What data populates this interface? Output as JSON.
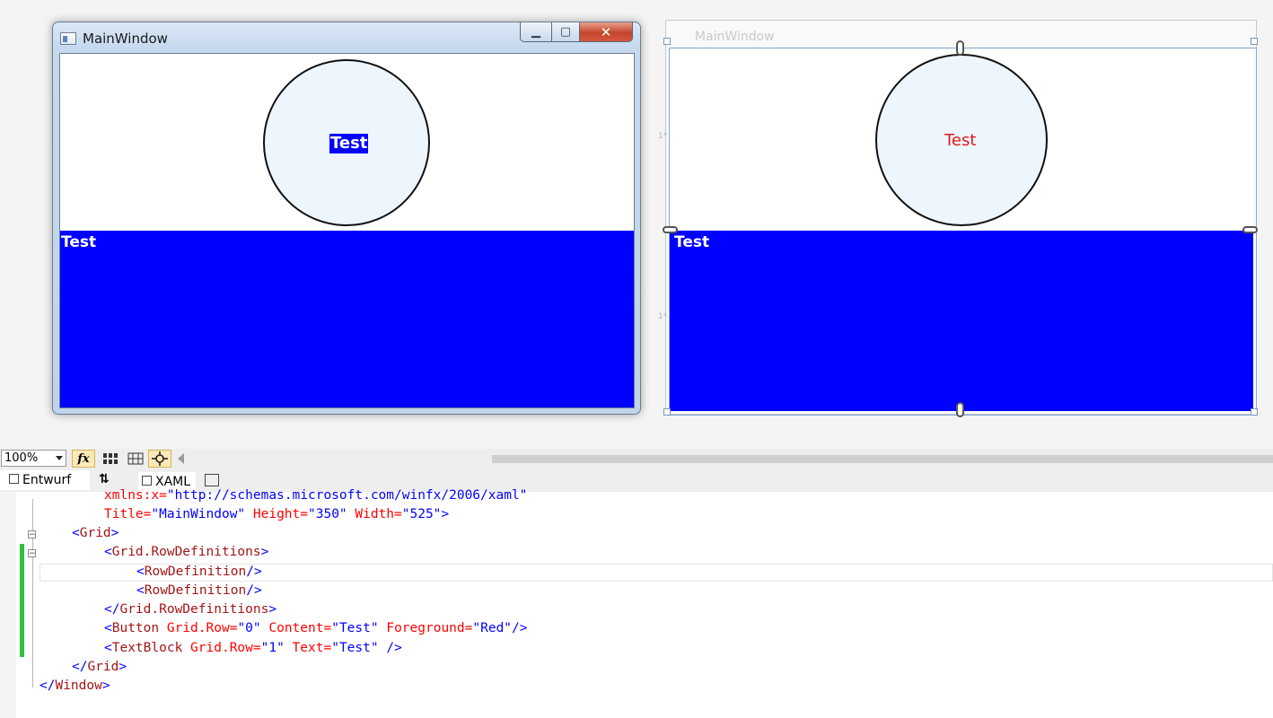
{
  "running_window": {
    "title": "MainWindow",
    "buttons": {
      "minimize": "▁",
      "maximize": "▢",
      "close": "✕"
    },
    "button_content": "Test",
    "textblock_text": "Test"
  },
  "designer": {
    "window_title": "MainWindow",
    "button_content": "Test",
    "textblock_text": "Test",
    "row_marker_0": "1*",
    "row_marker_1": "1*"
  },
  "toolbar": {
    "zoom": "100%",
    "fx_label": "fx"
  },
  "tabs": {
    "design": "Entwurf",
    "swap": "⇅",
    "xaml": "XAML"
  },
  "code": {
    "lines": [
      {
        "t1": "xmlns:x=",
        "v1": "\"http://schemas.microsoft.com/winfx/2006/xaml\""
      },
      {
        "a1": "Title=",
        "v1": "\"MainWindow\"",
        "a2": " Height=",
        "v2": "\"350\"",
        "a3": " Width=",
        "v3": "\"525\"",
        "p": ">"
      },
      {
        "p1": "<",
        "t": "Grid",
        "p2": ">"
      },
      {
        "p1": "<",
        "t": "Grid.RowDefinitions",
        "p2": ">"
      },
      {
        "p1": "<",
        "t": "RowDefinition",
        "p2": "/>"
      },
      {
        "p1": "<",
        "t": "RowDefinition",
        "p2": "/>"
      },
      {
        "p1": "</",
        "t": "Grid.RowDefinitions",
        "p2": ">"
      },
      {
        "p1": "<",
        "t": "Button",
        "a1": " Grid.Row=",
        "v1": "\"0\"",
        "a2": " Content=",
        "v2": "\"Test\"",
        "a3": " Foreground=",
        "v3": "\"Red\"",
        "p2": "/>"
      },
      {
        "p1": "<",
        "t": "TextBlock",
        "a1": " Grid.Row=",
        "v1": "\"1\"",
        "a2": " Text=",
        "v2": "\"Test\"",
        "p2": " />"
      },
      {
        "p1": "</",
        "t": "Grid",
        "p2": ">"
      },
      {
        "p1": "</",
        "t": "Window",
        "p2": ">"
      }
    ]
  },
  "colors": {
    "row_blue": "#0000ff",
    "button_foreground": "#ff0000",
    "change_bar": "#2ec13b"
  }
}
